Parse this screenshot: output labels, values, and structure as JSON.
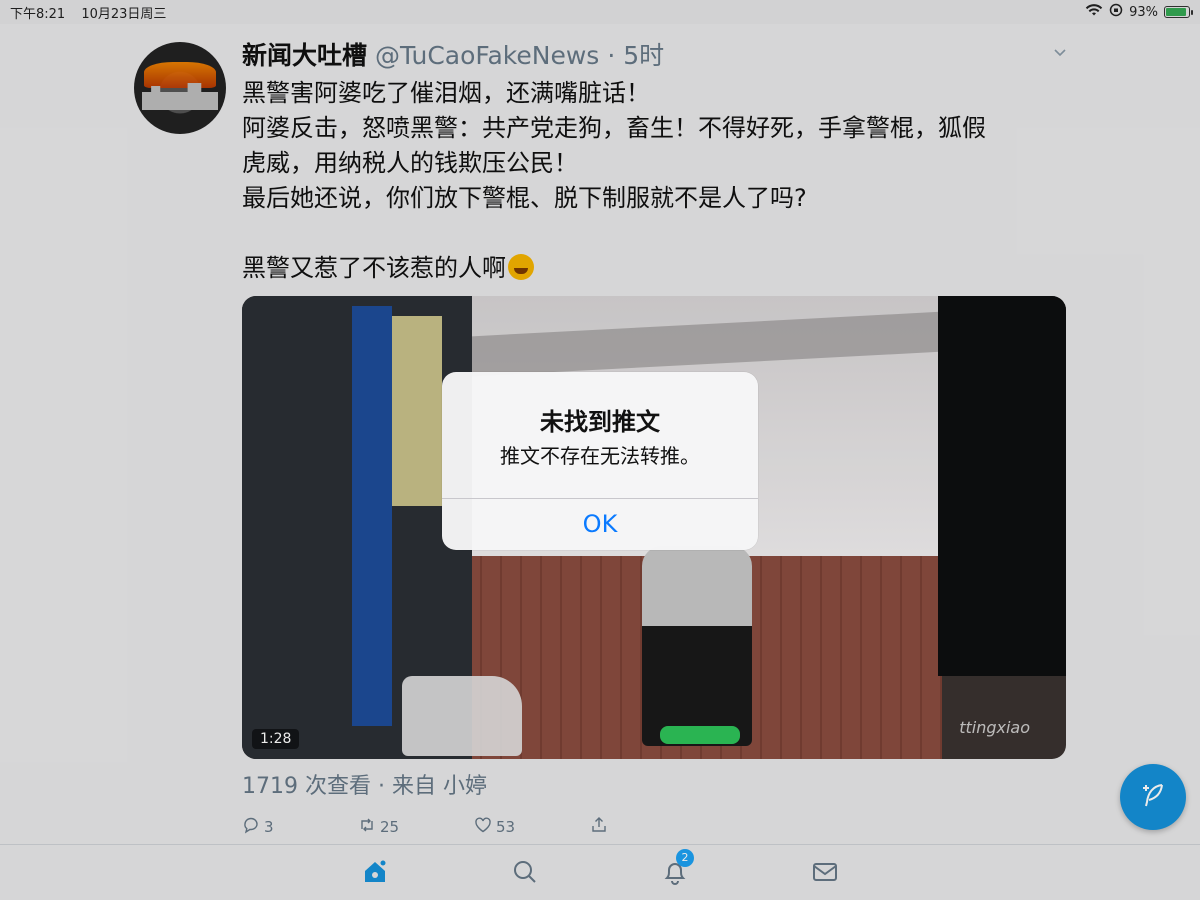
{
  "status_bar": {
    "time": "下午8:21",
    "date": "10月23日周三",
    "battery_percent": "93%"
  },
  "tweet": {
    "display_name": "新闻大吐槽",
    "handle": "@TuCaoFakeNews",
    "time_ago": "· 5时",
    "text_lines": [
      "黑警害阿婆吃了催泪烟，还满嘴脏话！",
      "阿婆反击，怒喷黑警：共产党走狗，畜生！不得好死，手拿警棍，狐假",
      "虎威，用纳税人的钱欺压公民！",
      "最后她还说，你们放下警棍、脱下制服就不是人了吗?",
      "",
      "黑警又惹了不该惹的人啊"
    ],
    "video": {
      "duration": "1:28",
      "watermark": "ttingxiao"
    },
    "video_meta": "1719 次查看 · 来自 小婷",
    "reply_count": "3",
    "retweet_count": "25",
    "like_count": "53"
  },
  "tab_bar": {
    "notifications_badge": "2"
  },
  "alert": {
    "title": "未找到推文",
    "message": "推文不存在无法转推。",
    "ok_label": "OK"
  },
  "colors": {
    "accent": "#1da1f2",
    "alert_button": "#0a7aff",
    "secondary_text": "#657786"
  }
}
